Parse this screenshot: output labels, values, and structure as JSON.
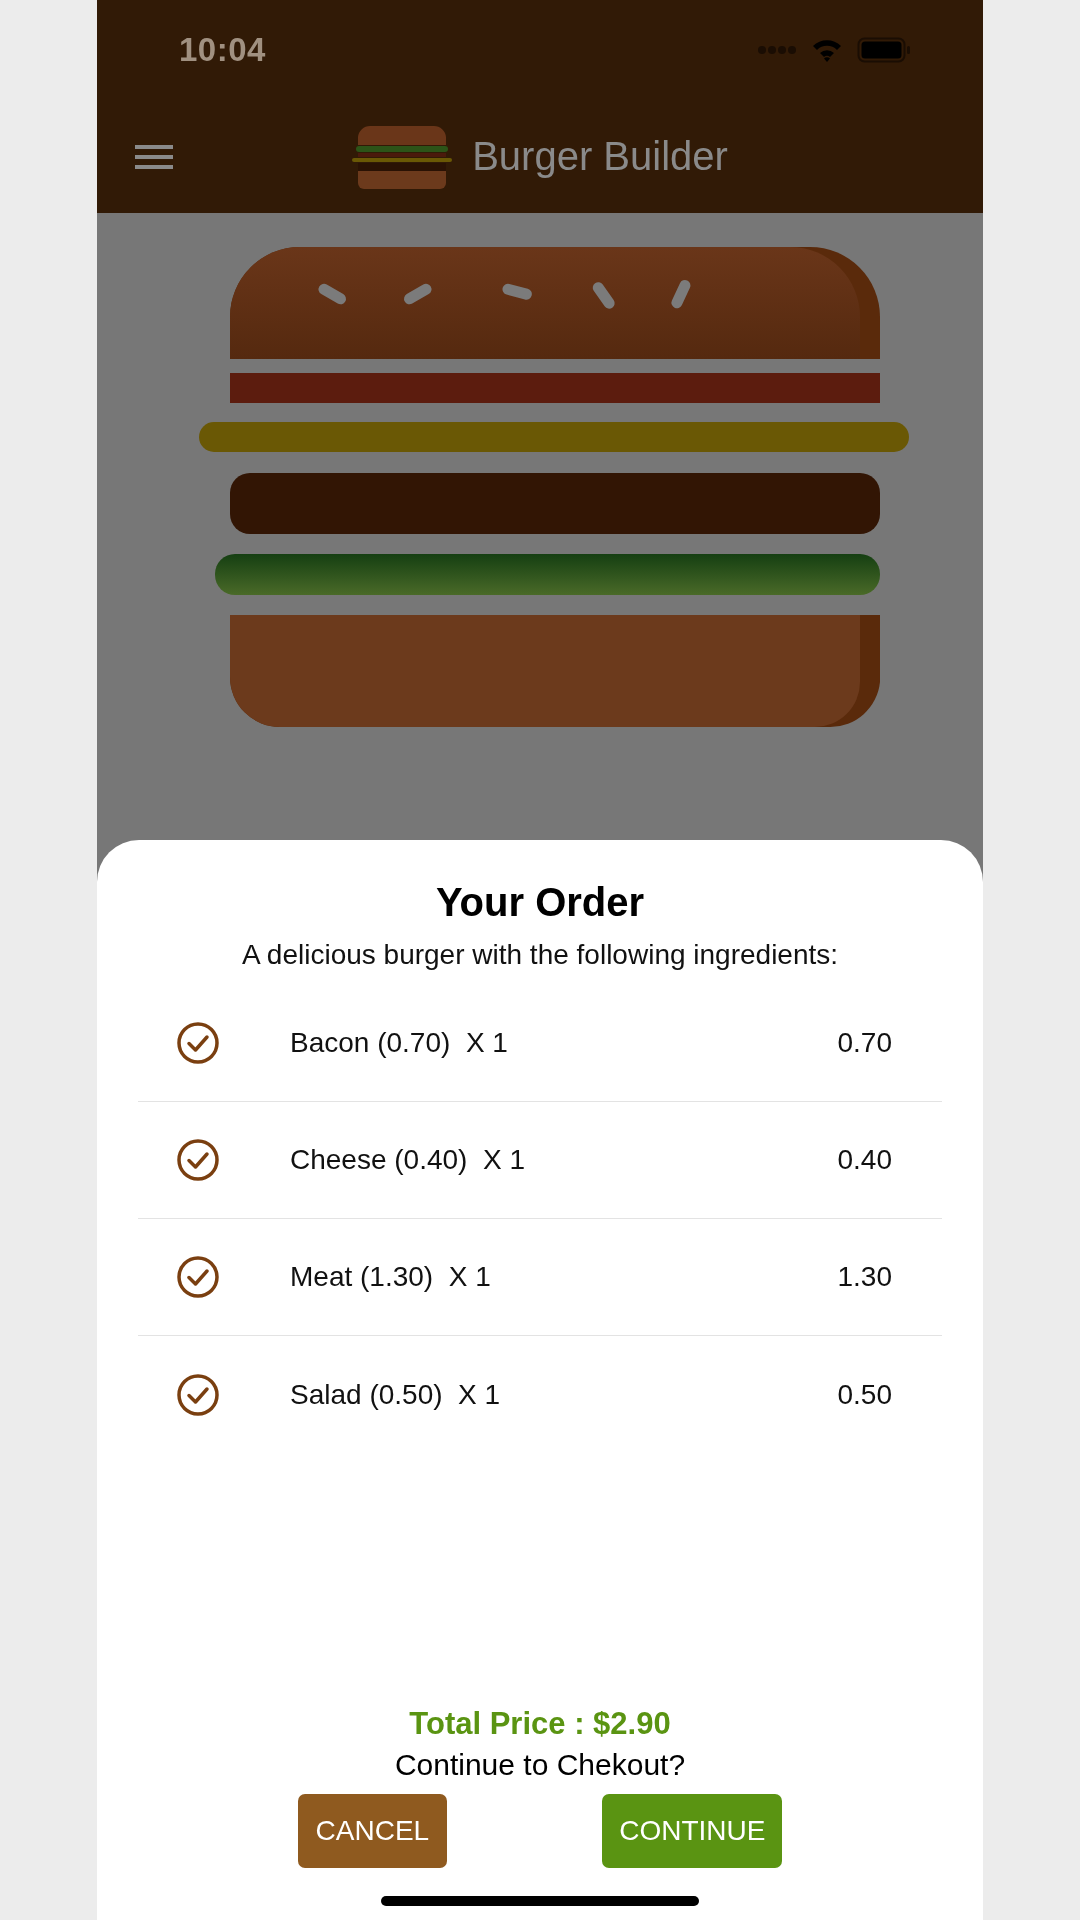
{
  "status_bar": {
    "time": "10:04"
  },
  "header": {
    "title": "Burger Builder"
  },
  "order": {
    "title": "Your Order",
    "subtitle": "A delicious burger with the following ingredients:",
    "items": [
      {
        "label": "Bacon (0.70)  X 1",
        "price": "0.70",
        "checked": true
      },
      {
        "label": "Cheese (0.40)  X 1",
        "price": "0.40",
        "checked": true
      },
      {
        "label": "Meat (1.30)  X 1",
        "price": "1.30",
        "checked": true
      },
      {
        "label": "Salad (0.50)  X 1",
        "price": "0.50",
        "checked": true
      }
    ],
    "total": "Total Price : $2.90",
    "question": "Continue to Chekout?",
    "buttons": [
      {
        "label": "CANCEL",
        "kind": "cancel"
      },
      {
        "label": "CONTINUE",
        "kind": "continue"
      }
    ]
  }
}
